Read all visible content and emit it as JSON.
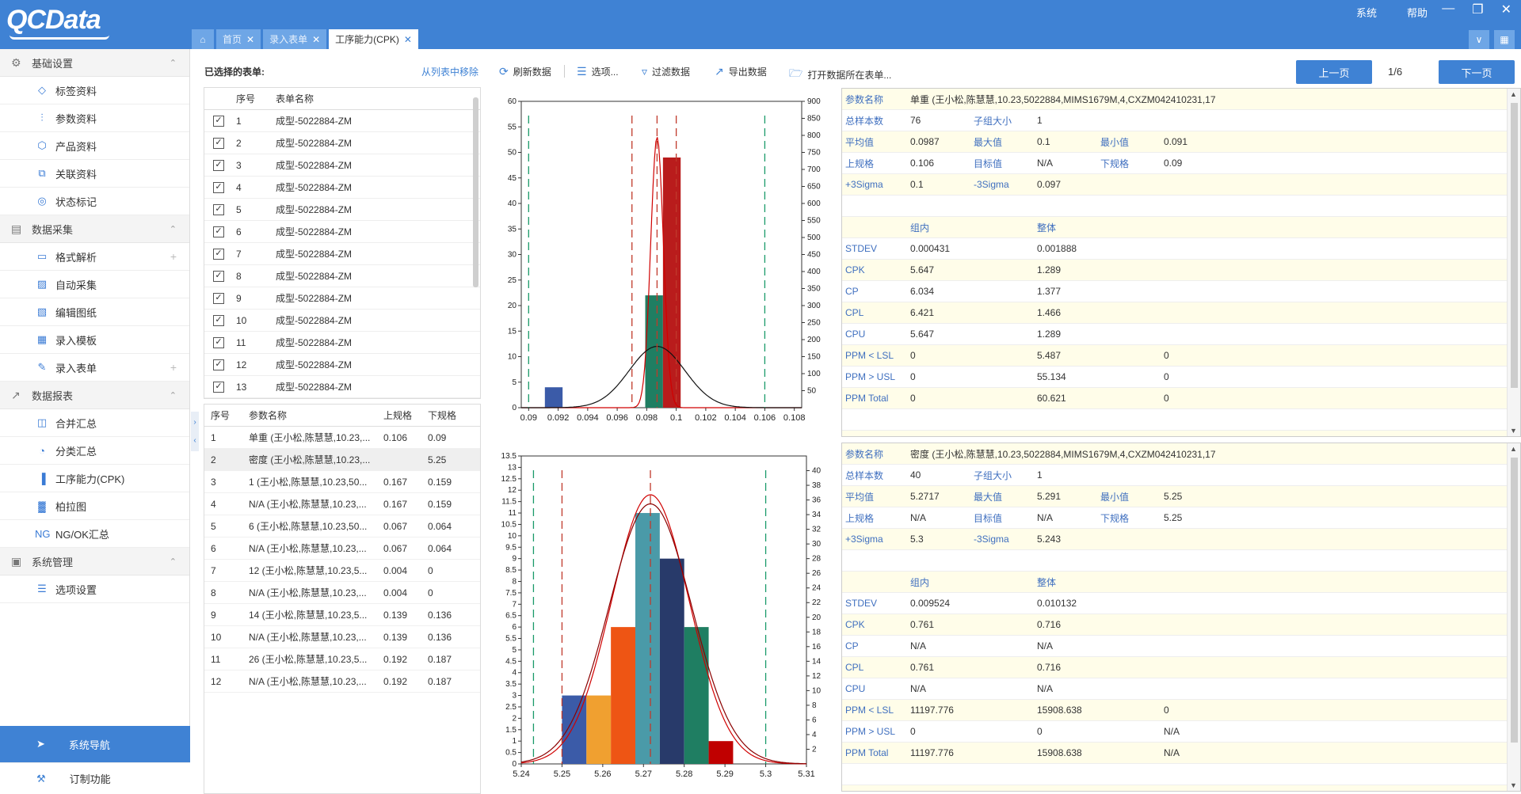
{
  "app": {
    "logo": "QCData",
    "menu": [
      "系统",
      "帮助"
    ]
  },
  "tabs": [
    {
      "label": "首页",
      "active": false
    },
    {
      "label": "录入表单",
      "active": false
    },
    {
      "label": "工序能力(CPK)",
      "active": true
    }
  ],
  "sidebar": {
    "groups": [
      {
        "label": "基础设置",
        "icon": "gear-icon",
        "items": [
          {
            "label": "标签资料",
            "icon": "tag-icon"
          },
          {
            "label": "参数资料",
            "icon": "sliders-icon"
          },
          {
            "label": "产品资料",
            "icon": "cube-icon"
          },
          {
            "label": "关联资料",
            "icon": "link-icon"
          },
          {
            "label": "状态标记",
            "icon": "target-icon"
          }
        ]
      },
      {
        "label": "数据采集",
        "icon": "collect-icon",
        "items": [
          {
            "label": "格式解析",
            "icon": "window-icon",
            "plus": true
          },
          {
            "label": "自动采集",
            "icon": "auto-icon"
          },
          {
            "label": "编辑图纸",
            "icon": "edit-drawing-icon"
          },
          {
            "label": "录入模板",
            "icon": "template-icon"
          },
          {
            "label": "录入表单",
            "icon": "pencil-icon",
            "plus": true
          }
        ]
      },
      {
        "label": "数据报表",
        "icon": "report-icon",
        "items": [
          {
            "label": "合并汇总",
            "icon": "merge-icon"
          },
          {
            "label": "分类汇总",
            "icon": "pie-icon"
          },
          {
            "label": "工序能力(CPK)",
            "icon": "bar-chart-icon"
          },
          {
            "label": "柏拉图",
            "icon": "pareto-icon"
          },
          {
            "label": "NG/OK汇总",
            "icon": "ng-icon"
          }
        ]
      },
      {
        "label": "系统管理",
        "icon": "system-icon",
        "items": [
          {
            "label": "选项设置",
            "icon": "list-icon"
          }
        ]
      }
    ],
    "nav_button": "系统导航",
    "custom_button": "订制功能"
  },
  "selected_forms": {
    "title": "已选择的表单:",
    "remove_link": "从列表中移除",
    "headers": [
      "序号",
      "表单名称"
    ],
    "rows": [
      [
        "1",
        "成型-5022884-ZM"
      ],
      [
        "2",
        "成型-5022884-ZM"
      ],
      [
        "3",
        "成型-5022884-ZM"
      ],
      [
        "4",
        "成型-5022884-ZM"
      ],
      [
        "5",
        "成型-5022884-ZM"
      ],
      [
        "6",
        "成型-5022884-ZM"
      ],
      [
        "7",
        "成型-5022884-ZM"
      ],
      [
        "8",
        "成型-5022884-ZM"
      ],
      [
        "9",
        "成型-5022884-ZM"
      ],
      [
        "10",
        "成型-5022884-ZM"
      ],
      [
        "11",
        "成型-5022884-ZM"
      ],
      [
        "12",
        "成型-5022884-ZM"
      ],
      [
        "13",
        "成型-5022884-ZM"
      ]
    ]
  },
  "params": {
    "headers": [
      "序号",
      "参数名称",
      "上规格",
      "下规格"
    ],
    "rows": [
      [
        "1",
        "单重 (王小松,陈慧慧,10.23,...",
        "0.106",
        "0.09"
      ],
      [
        "2",
        "密度 (王小松,陈慧慧,10.23,...",
        "",
        "5.25"
      ],
      [
        "3",
        "1 (王小松,陈慧慧,10.23,50...",
        "0.167",
        "0.159"
      ],
      [
        "4",
        "N/A (王小松,陈慧慧,10.23,...",
        "0.167",
        "0.159"
      ],
      [
        "5",
        "6 (王小松,陈慧慧,10.23,50...",
        "0.067",
        "0.064"
      ],
      [
        "6",
        "N/A (王小松,陈慧慧,10.23,...",
        "0.067",
        "0.064"
      ],
      [
        "7",
        "12 (王小松,陈慧慧,10.23,5...",
        "0.004",
        "0"
      ],
      [
        "8",
        "N/A (王小松,陈慧慧,10.23,...",
        "0.004",
        "0"
      ],
      [
        "9",
        "14 (王小松,陈慧慧,10.23,5...",
        "0.139",
        "0.136"
      ],
      [
        "10",
        "N/A (王小松,陈慧慧,10.23,...",
        "0.139",
        "0.136"
      ],
      [
        "11",
        "26 (王小松,陈慧慧,10.23,5...",
        "0.192",
        "0.187"
      ],
      [
        "12",
        "N/A (王小松,陈慧慧,10.23,...",
        "0.192",
        "0.187"
      ]
    ],
    "selected_index": 1
  },
  "toolbar": {
    "refresh": "刷新数据",
    "options": "选项...",
    "filter": "过滤数据",
    "export": "导出数据",
    "open_form": "打开数据所在表单...",
    "prev": "上一页",
    "page": "1/6",
    "next": "下一页"
  },
  "stats": [
    {
      "param_label": "参数名称",
      "param_value": "单重 (王小松,陈慧慧,10.23,5022884,MIMS1679M,4,CXZM042410231,17",
      "r1": [
        "总样本数",
        "76",
        "子组大小",
        "1"
      ],
      "r2": [
        "平均值",
        "0.0987",
        "最大值",
        "0.1",
        "最小值",
        "0.091"
      ],
      "r3": [
        "上规格",
        "0.106",
        "目标值",
        "N/A",
        "下规格",
        "0.09"
      ],
      "r4": [
        "+3Sigma",
        "0.1",
        "-3Sigma",
        "0.097"
      ],
      "cols": [
        "组内",
        "整体"
      ],
      "metrics": [
        [
          "STDEV",
          "0.000431",
          "0.001888",
          ""
        ],
        [
          "CPK",
          "5.647",
          "1.289",
          ""
        ],
        [
          "CP",
          "6.034",
          "1.377",
          ""
        ],
        [
          "CPL",
          "6.421",
          "1.466",
          ""
        ],
        [
          "CPU",
          "5.647",
          "1.289",
          ""
        ],
        [
          "PPM < LSL",
          "0",
          "5.487",
          "0"
        ],
        [
          "PPM > USL",
          "0",
          "55.134",
          "0"
        ],
        [
          "PPM Total",
          "0",
          "60.621",
          "0"
        ]
      ]
    },
    {
      "param_label": "参数名称",
      "param_value": "密度 (王小松,陈慧慧,10.23,5022884,MIMS1679M,4,CXZM042410231,17",
      "r1": [
        "总样本数",
        "40",
        "子组大小",
        "1"
      ],
      "r2": [
        "平均值",
        "5.2717",
        "最大值",
        "5.291",
        "最小值",
        "5.25"
      ],
      "r3": [
        "上规格",
        "N/A",
        "目标值",
        "N/A",
        "下规格",
        "5.25"
      ],
      "r4": [
        "+3Sigma",
        "5.3",
        "-3Sigma",
        "5.243"
      ],
      "cols": [
        "组内",
        "整体"
      ],
      "metrics": [
        [
          "STDEV",
          "0.009524",
          "0.010132",
          ""
        ],
        [
          "CPK",
          "0.761",
          "0.716",
          ""
        ],
        [
          "CP",
          "N/A",
          "N/A",
          ""
        ],
        [
          "CPL",
          "0.761",
          "0.716",
          ""
        ],
        [
          "CPU",
          "N/A",
          "N/A",
          ""
        ],
        [
          "PPM < LSL",
          "11197.776",
          "15908.638",
          "0"
        ],
        [
          "PPM > USL",
          "0",
          "0",
          "N/A"
        ],
        [
          "PPM Total",
          "11197.776",
          "15908.638",
          "N/A"
        ]
      ]
    }
  ],
  "chart_data": [
    {
      "type": "bar",
      "title": "",
      "x_ticks": [
        "0.09",
        "0.092",
        "0.094",
        "0.096",
        "0.098",
        "0.1",
        "0.102",
        "0.104",
        "0.106",
        "0.108"
      ],
      "xlim": [
        0.0895,
        0.1085
      ],
      "ylim_left": [
        0,
        60
      ],
      "y_left_ticks": [
        0,
        5,
        10,
        15,
        20,
        25,
        30,
        35,
        40,
        45,
        50,
        55,
        60
      ],
      "ylim_right": [
        0,
        900
      ],
      "y_right_ticks": [
        50,
        100,
        150,
        200,
        250,
        300,
        350,
        400,
        450,
        500,
        550,
        600,
        650,
        700,
        750,
        800,
        850,
        900
      ],
      "bars": [
        {
          "x0": 0.0911,
          "x1": 0.0923,
          "value": 4,
          "color": "#3b5ba8"
        },
        {
          "x0": 0.0979,
          "x1": 0.0991,
          "value": 22,
          "color": "#1f7e62"
        },
        {
          "x0": 0.0991,
          "x1": 0.1003,
          "value": 49,
          "color": "#b91c1c"
        }
      ],
      "lsl": 0.09,
      "usl": 0.106,
      "minus3sigma": 0.097,
      "plus3sigma": 0.1,
      "mean": 0.0987,
      "curves": [
        {
          "name": "",
          "color": "#d00000",
          "mean": 0.0987,
          "sd": 0.000431,
          "peak": 53
        },
        {
          "name": "",
          "color": "#111111",
          "mean": 0.0987,
          "sd": 0.001888,
          "peak": 12
        }
      ],
      "grid": false
    },
    {
      "type": "bar",
      "title": "",
      "x_ticks": [
        "5.24",
        "5.25",
        "5.26",
        "5.27",
        "5.28",
        "5.29",
        "5.3",
        "5.31"
      ],
      "xlim": [
        5.24,
        5.31
      ],
      "ylim_left": [
        0,
        13.5
      ],
      "y_left_ticks": [
        0,
        0.5,
        1,
        1.5,
        2,
        2.5,
        3,
        3.5,
        4,
        4.5,
        5,
        5.5,
        6,
        6.5,
        7,
        7.5,
        8,
        8.5,
        9,
        9.5,
        10,
        10.5,
        11,
        11.5,
        12,
        12.5,
        13,
        13.5
      ],
      "ylim_right": [
        0,
        42
      ],
      "y_right_ticks": [
        2,
        4,
        6,
        8,
        10,
        12,
        14,
        16,
        18,
        20,
        22,
        24,
        26,
        28,
        30,
        32,
        34,
        36,
        38,
        40
      ],
      "bars": [
        {
          "x0": 5.25,
          "x1": 5.256,
          "value": 3,
          "color": "#3b5ba8"
        },
        {
          "x0": 5.256,
          "x1": 5.262,
          "value": 3,
          "color": "#f0a030"
        },
        {
          "x0": 5.262,
          "x1": 5.268,
          "value": 6,
          "color": "#ee5514"
        },
        {
          "x0": 5.268,
          "x1": 5.274,
          "value": 11,
          "color": "#4a9aa8"
        },
        {
          "x0": 5.274,
          "x1": 5.28,
          "value": 9,
          "color": "#283a6a"
        },
        {
          "x0": 5.28,
          "x1": 5.286,
          "value": 6,
          "color": "#1f7e62"
        },
        {
          "x0": 5.286,
          "x1": 5.292,
          "value": 1,
          "color": "#c00000"
        }
      ],
      "lsl": 5.243,
      "usl": 5.3,
      "minus3sigma": 5.25,
      "plus3sigma": null,
      "mean": 5.2717,
      "curves": [
        {
          "name": "",
          "color": "#d00000",
          "mean": 5.2717,
          "sd": 0.009524,
          "peak": 11.8
        },
        {
          "name": "",
          "color": "#8b0000",
          "mean": 5.2717,
          "sd": 0.010132,
          "peak": 11.4
        }
      ],
      "grid": false
    }
  ]
}
